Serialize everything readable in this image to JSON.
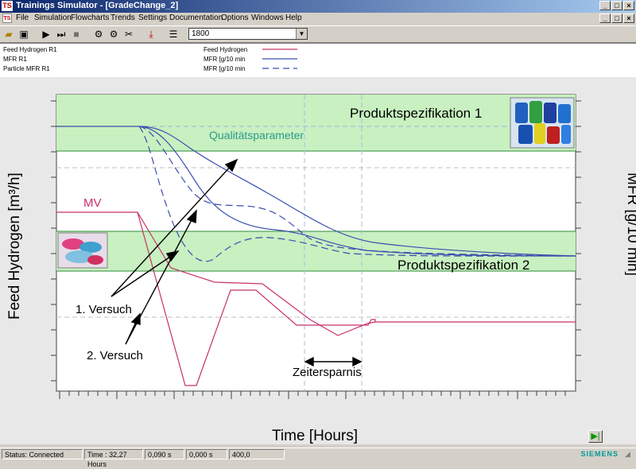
{
  "window": {
    "title": "Trainings Simulator - [GradeChange_2]",
    "app_badge": "TS"
  },
  "menu": [
    "File",
    "Simulation",
    "Flowcharts",
    "Trends",
    "Settings",
    "Documentation",
    "Options",
    "Windows",
    "Help"
  ],
  "toolbar": {
    "combo_value": "1800"
  },
  "legend": {
    "rows": [
      {
        "tag": "Feed Hydrogen R1",
        "name": "Feed Hydrogen",
        "color": "#c8306a",
        "style": "solid"
      },
      {
        "tag": "MFR R1",
        "name": "MFR [g/10 min",
        "color": "#3a4db0",
        "style": "solid"
      },
      {
        "tag": "Particle MFR R1",
        "name": "MFR [g/10 min",
        "color": "#3a4db0",
        "style": "dashed"
      }
    ]
  },
  "chart": {
    "ylabel_left": "Feed Hydrogen [m³/h]",
    "ylabel_right": "MFR [g/10 min]",
    "xlabel": "Time [Hours]",
    "band1_label": "Produktspezifikation 1",
    "band2_label": "Produktspezifikation 2",
    "quality_label": "Qualitätsparameter",
    "mv_label": "MV",
    "try1_label": "1. Versuch",
    "try2_label": "2. Versuch",
    "saving_label": "Zeitersparnis",
    "colors": {
      "band": "#c8f0c0",
      "mfr": "#3a4db0",
      "hydrogen": "#c8306a",
      "label": "#2a9a8a"
    }
  },
  "status": {
    "state": "Status: Connected",
    "time": "Time : 32,27 Hours",
    "f1": "0,090 s",
    "f2": "0,000 s",
    "f3": "400,0",
    "brand": "SIEMENS"
  }
}
